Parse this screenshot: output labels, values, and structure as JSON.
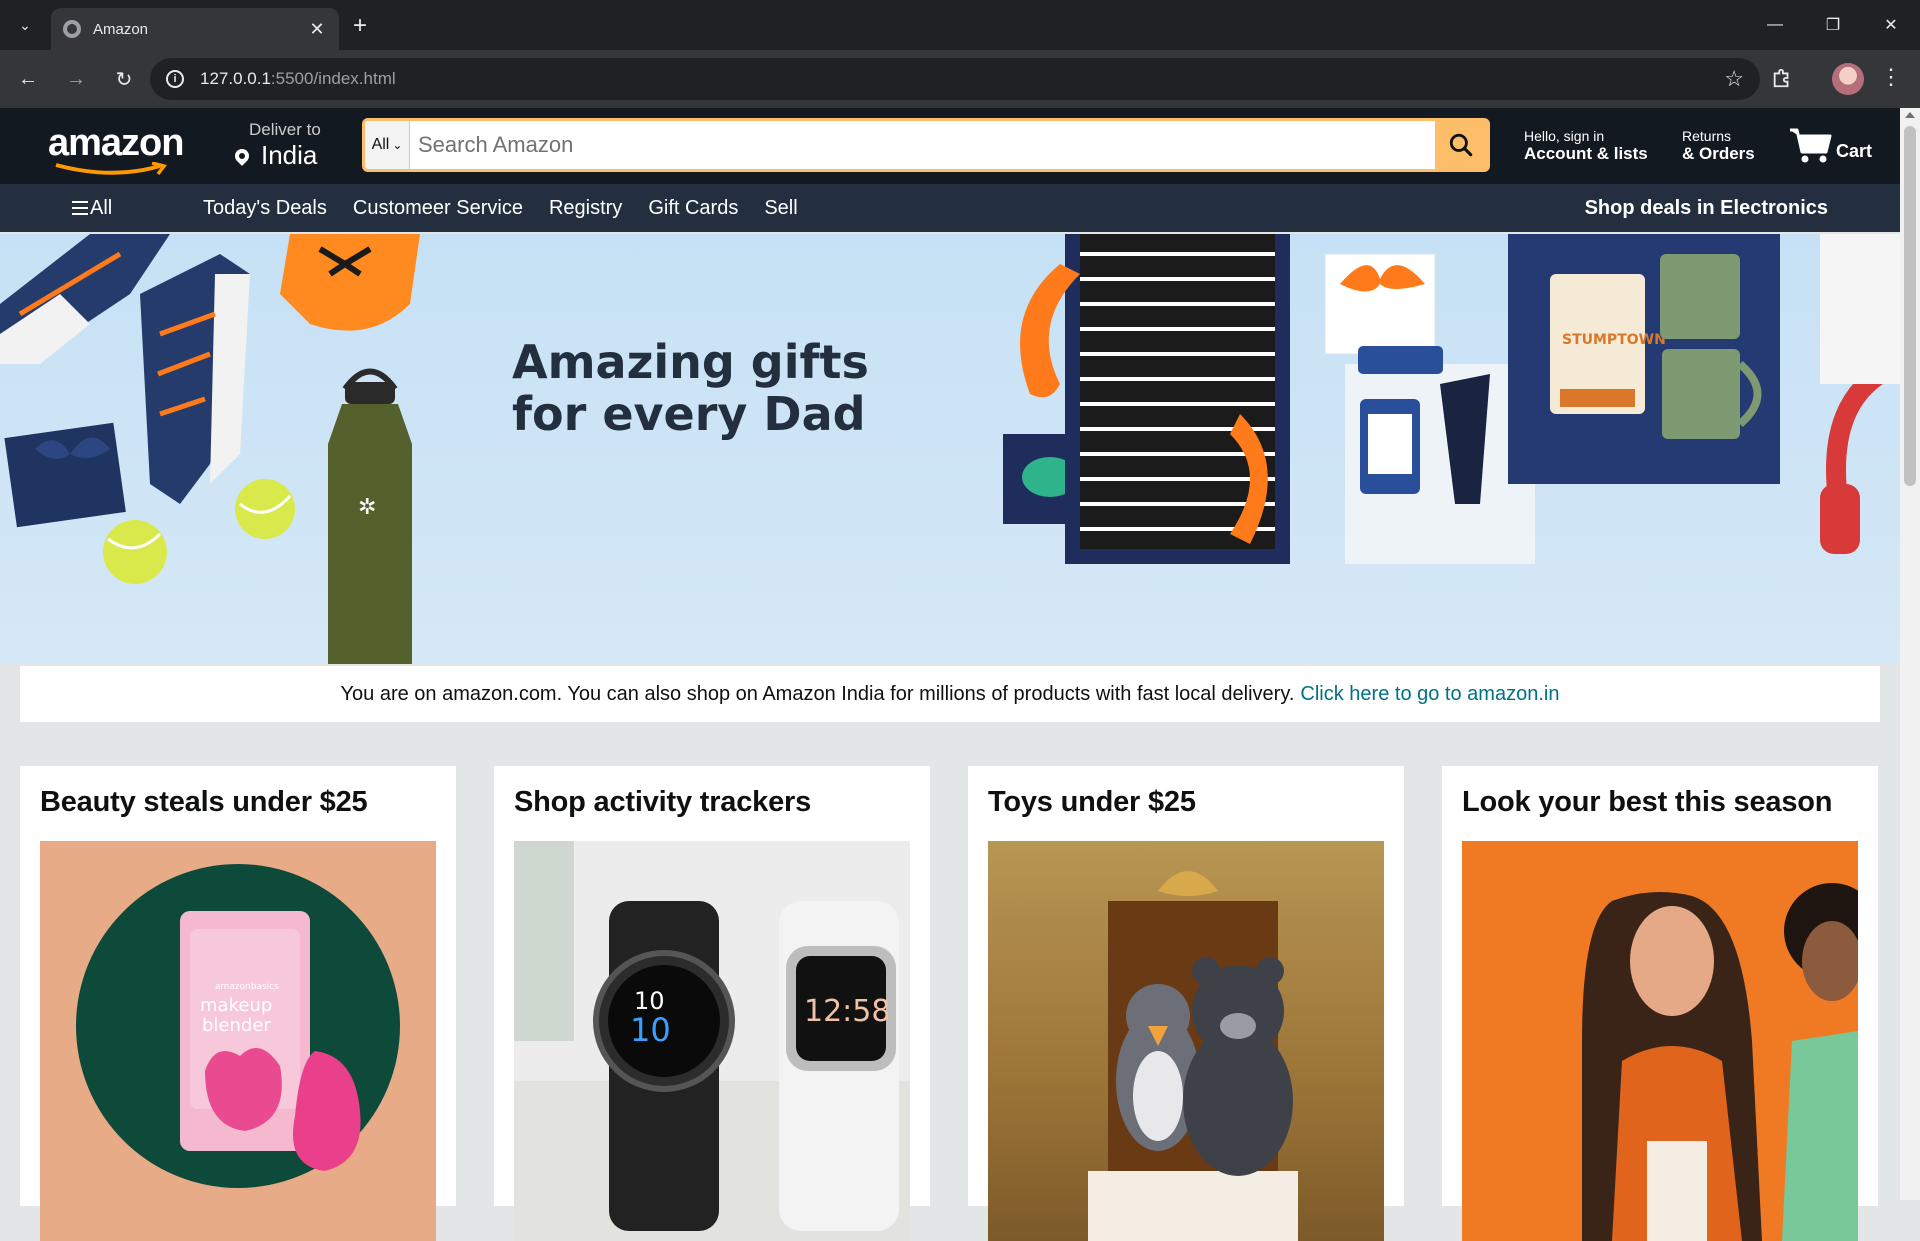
{
  "browser": {
    "tab_title": "Amazon",
    "url_host": "127.0.0.1",
    "url_rest": ":5500/index.html"
  },
  "header": {
    "logo": "amazon",
    "deliver_top": "Deliver to",
    "deliver_location": "India",
    "search_category": "All",
    "search_placeholder": "Search Amazon",
    "account_top": "Hello, sign in",
    "account_bottom": "Account & lists",
    "returns_top": "Returns",
    "returns_bottom": "& Orders",
    "cart_label": "Cart"
  },
  "nav": {
    "all_label": "All",
    "links": [
      "Today's Deals",
      "Customeer Service",
      "Registry",
      "Gift Cards",
      "Sell"
    ],
    "promo": "Shop deals in Electronics"
  },
  "hero": {
    "title_line1": "Amazing gifts",
    "title_line2": "for every Dad"
  },
  "notice": {
    "text": "You are on amazon.com. You can also shop on Amazon India for millions of products with fast local delivery.",
    "link": "Click here to go to amazon.in"
  },
  "cards": [
    {
      "title": "Beauty steals under $25",
      "img_text_1": "amazonbasics",
      "img_text_2": "makeup",
      "img_text_3": "blender"
    },
    {
      "title": "Shop activity trackers",
      "img_text_1": "10",
      "img_text_2": "10",
      "img_text_3": "12:58"
    },
    {
      "title": "Toys under $25"
    },
    {
      "title": "Look your best this season"
    }
  ],
  "colors": {
    "header_bg": "#131921",
    "nav_bg": "#232f3e",
    "accent": "#febd69",
    "link": "#007185",
    "hero_bg": "#c6e1f5"
  }
}
